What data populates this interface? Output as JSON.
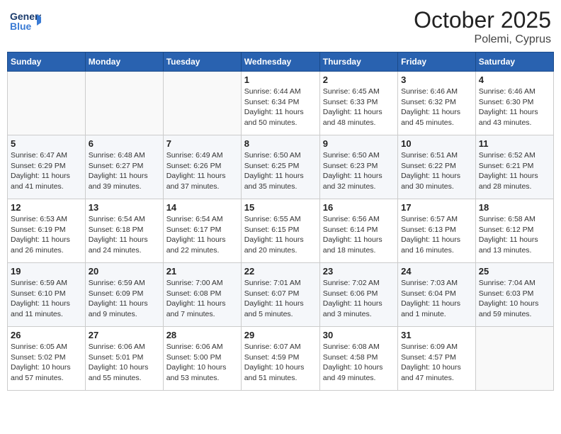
{
  "header": {
    "logo_general": "General",
    "logo_blue": "Blue",
    "month": "October 2025",
    "location": "Polemi, Cyprus"
  },
  "weekdays": [
    "Sunday",
    "Monday",
    "Tuesday",
    "Wednesday",
    "Thursday",
    "Friday",
    "Saturday"
  ],
  "weeks": [
    [
      {
        "day": "",
        "info": ""
      },
      {
        "day": "",
        "info": ""
      },
      {
        "day": "",
        "info": ""
      },
      {
        "day": "1",
        "info": "Sunrise: 6:44 AM\nSunset: 6:34 PM\nDaylight: 11 hours\nand 50 minutes."
      },
      {
        "day": "2",
        "info": "Sunrise: 6:45 AM\nSunset: 6:33 PM\nDaylight: 11 hours\nand 48 minutes."
      },
      {
        "day": "3",
        "info": "Sunrise: 6:46 AM\nSunset: 6:32 PM\nDaylight: 11 hours\nand 45 minutes."
      },
      {
        "day": "4",
        "info": "Sunrise: 6:46 AM\nSunset: 6:30 PM\nDaylight: 11 hours\nand 43 minutes."
      }
    ],
    [
      {
        "day": "5",
        "info": "Sunrise: 6:47 AM\nSunset: 6:29 PM\nDaylight: 11 hours\nand 41 minutes."
      },
      {
        "day": "6",
        "info": "Sunrise: 6:48 AM\nSunset: 6:27 PM\nDaylight: 11 hours\nand 39 minutes."
      },
      {
        "day": "7",
        "info": "Sunrise: 6:49 AM\nSunset: 6:26 PM\nDaylight: 11 hours\nand 37 minutes."
      },
      {
        "day": "8",
        "info": "Sunrise: 6:50 AM\nSunset: 6:25 PM\nDaylight: 11 hours\nand 35 minutes."
      },
      {
        "day": "9",
        "info": "Sunrise: 6:50 AM\nSunset: 6:23 PM\nDaylight: 11 hours\nand 32 minutes."
      },
      {
        "day": "10",
        "info": "Sunrise: 6:51 AM\nSunset: 6:22 PM\nDaylight: 11 hours\nand 30 minutes."
      },
      {
        "day": "11",
        "info": "Sunrise: 6:52 AM\nSunset: 6:21 PM\nDaylight: 11 hours\nand 28 minutes."
      }
    ],
    [
      {
        "day": "12",
        "info": "Sunrise: 6:53 AM\nSunset: 6:19 PM\nDaylight: 11 hours\nand 26 minutes."
      },
      {
        "day": "13",
        "info": "Sunrise: 6:54 AM\nSunset: 6:18 PM\nDaylight: 11 hours\nand 24 minutes."
      },
      {
        "day": "14",
        "info": "Sunrise: 6:54 AM\nSunset: 6:17 PM\nDaylight: 11 hours\nand 22 minutes."
      },
      {
        "day": "15",
        "info": "Sunrise: 6:55 AM\nSunset: 6:15 PM\nDaylight: 11 hours\nand 20 minutes."
      },
      {
        "day": "16",
        "info": "Sunrise: 6:56 AM\nSunset: 6:14 PM\nDaylight: 11 hours\nand 18 minutes."
      },
      {
        "day": "17",
        "info": "Sunrise: 6:57 AM\nSunset: 6:13 PM\nDaylight: 11 hours\nand 16 minutes."
      },
      {
        "day": "18",
        "info": "Sunrise: 6:58 AM\nSunset: 6:12 PM\nDaylight: 11 hours\nand 13 minutes."
      }
    ],
    [
      {
        "day": "19",
        "info": "Sunrise: 6:59 AM\nSunset: 6:10 PM\nDaylight: 11 hours\nand 11 minutes."
      },
      {
        "day": "20",
        "info": "Sunrise: 6:59 AM\nSunset: 6:09 PM\nDaylight: 11 hours\nand 9 minutes."
      },
      {
        "day": "21",
        "info": "Sunrise: 7:00 AM\nSunset: 6:08 PM\nDaylight: 11 hours\nand 7 minutes."
      },
      {
        "day": "22",
        "info": "Sunrise: 7:01 AM\nSunset: 6:07 PM\nDaylight: 11 hours\nand 5 minutes."
      },
      {
        "day": "23",
        "info": "Sunrise: 7:02 AM\nSunset: 6:06 PM\nDaylight: 11 hours\nand 3 minutes."
      },
      {
        "day": "24",
        "info": "Sunrise: 7:03 AM\nSunset: 6:04 PM\nDaylight: 11 hours\nand 1 minute."
      },
      {
        "day": "25",
        "info": "Sunrise: 7:04 AM\nSunset: 6:03 PM\nDaylight: 10 hours\nand 59 minutes."
      }
    ],
    [
      {
        "day": "26",
        "info": "Sunrise: 6:05 AM\nSunset: 5:02 PM\nDaylight: 10 hours\nand 57 minutes."
      },
      {
        "day": "27",
        "info": "Sunrise: 6:06 AM\nSunset: 5:01 PM\nDaylight: 10 hours\nand 55 minutes."
      },
      {
        "day": "28",
        "info": "Sunrise: 6:06 AM\nSunset: 5:00 PM\nDaylight: 10 hours\nand 53 minutes."
      },
      {
        "day": "29",
        "info": "Sunrise: 6:07 AM\nSunset: 4:59 PM\nDaylight: 10 hours\nand 51 minutes."
      },
      {
        "day": "30",
        "info": "Sunrise: 6:08 AM\nSunset: 4:58 PM\nDaylight: 10 hours\nand 49 minutes."
      },
      {
        "day": "31",
        "info": "Sunrise: 6:09 AM\nSunset: 4:57 PM\nDaylight: 10 hours\nand 47 minutes."
      },
      {
        "day": "",
        "info": ""
      }
    ]
  ]
}
